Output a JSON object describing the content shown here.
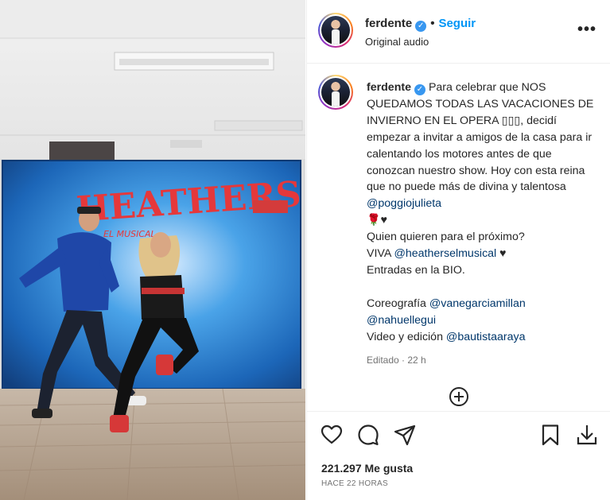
{
  "media": {
    "banner_title": "HEATHERS",
    "banner_subtitle": "EL MUSICAL"
  },
  "header": {
    "username": "ferdente",
    "verified_mark": "✓",
    "separator": "•",
    "follow_label": "Seguir",
    "subtitle": "Original audio",
    "more_label": "•••"
  },
  "caption": {
    "username": "ferdente",
    "text_intro": "Para celebrar que NOS QUEDAMOS TODAS LAS VACACIONES DE INVIERNO EN EL OPERA ▯▯▯, decidí empezar a invitar a amigos de la casa para ir calentando los motores antes de que conozcan nuestro show. Hoy con esta reina que no puede más de divina y talentosa",
    "mention_1": "@poggiojulieta",
    "emoji_line": "🌹♥",
    "line_question": "Quien quieren para el próximo?",
    "viva_prefix": "VIVA",
    "mention_2": "@heatherselmusical",
    "heart": "♥",
    "line_tickets": "Entradas en la BIO.",
    "choreo_prefix": "Coreografía",
    "mention_3": "@vanegarciamillan",
    "mention_4": "@nahuellegui",
    "video_prefix": "Video y edición",
    "mention_5": "@bautistaaraya",
    "edited": "Editado · 22 h"
  },
  "actions": {
    "likes": "221.297 Me gusta",
    "time_ago": "HACE 22 HORAS"
  },
  "icons": {
    "like": "heart-outline-icon",
    "comment": "comment-bubble-icon",
    "share": "paper-plane-icon",
    "save": "bookmark-icon",
    "download": "download-tray-icon",
    "add": "plus-circle-icon"
  }
}
